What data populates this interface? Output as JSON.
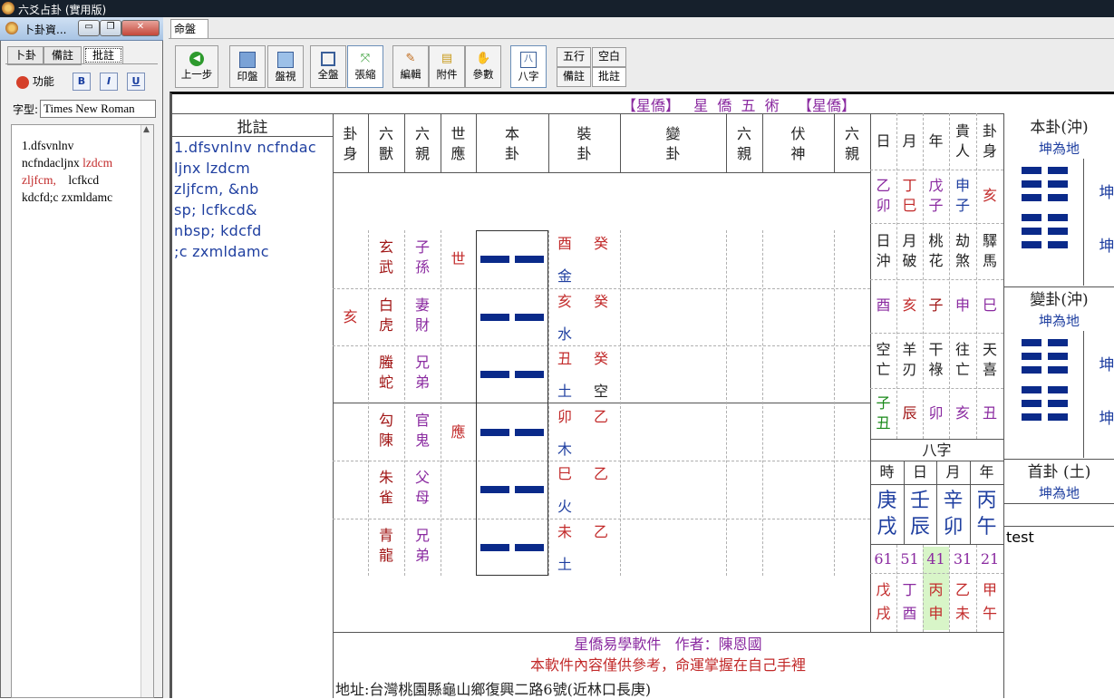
{
  "app": {
    "title": "六爻占卦 (實用版)"
  },
  "mdi_tab": "命盤",
  "toolbar": {
    "prev": "上一步",
    "print": "印盤",
    "view": "盤視",
    "full": "全盤",
    "shrink": "張縮",
    "edit": "編輯",
    "attach": "附件",
    "params": "參數",
    "bazi": "八字",
    "wuxing": "五行",
    "kongbai": "空白",
    "beizhu": "備註",
    "pizhu": "批註"
  },
  "left_panel": {
    "title": "卜卦資...",
    "tabs": [
      "卜卦",
      "備註",
      "批註"
    ],
    "func_label": "功能",
    "bold_label": "B",
    "italic_label": "I",
    "underline_label": "U",
    "font_label": "字型:",
    "font_value": "Times New Roman",
    "memo_lines": [
      [
        {
          "text": "1.dfsvnlnv",
          "c": "#000"
        }
      ],
      [
        {
          "text": "ncfndacljnx ",
          "c": "#000"
        },
        {
          "text": "lzdcm",
          "c": "#c22a2a"
        }
      ],
      [
        {
          "text": "zljfcm,",
          "c": "#c22a2a"
        },
        {
          "text": "    lcfkcd",
          "c": "#000"
        }
      ],
      [
        {
          "text": "kdcfd;c zxmldamc",
          "c": "#000"
        }
      ]
    ]
  },
  "doc": {
    "banner": "【星僑】   星  僑  五  術    【星僑】",
    "pizhu_header": "批註",
    "pizhu_lines": [
      "1.dfsvnlnv ncfndac",
      "ljnx lzdcm",
      "zljfcm, &nb",
      "sp; lcfkcd&",
      "nbsp; kdcfd",
      ";c zxmldamc"
    ],
    "col_headers": [
      "卦身",
      "六獸",
      "六親",
      "世應",
      "本卦",
      "裝卦",
      "變卦",
      "六親",
      "伏神",
      "六親"
    ],
    "rows": [
      {
        "guashen": "",
        "shou": "玄武",
        "qin": "子孫",
        "shiying": "世",
        "zhi": "酉",
        "gan": "癸",
        "wx": "金",
        "kong": ""
      },
      {
        "guashen": "亥",
        "shou": "白虎",
        "qin": "妻財",
        "shiying": "",
        "zhi": "亥",
        "gan": "癸",
        "wx": "水",
        "kong": ""
      },
      {
        "guashen": "",
        "shou": "螣蛇",
        "qin": "兄弟",
        "shiying": "",
        "zhi": "丑",
        "gan": "癸",
        "wx": "土",
        "kong": "空"
      },
      {
        "guashen": "",
        "shou": "勾陳",
        "qin": "官鬼",
        "shiying": "應",
        "zhi": "卯",
        "gan": "乙",
        "wx": "木",
        "kong": ""
      },
      {
        "guashen": "",
        "shou": "朱雀",
        "qin": "父母",
        "shiying": "",
        "zhi": "巳",
        "gan": "乙",
        "wx": "火",
        "kong": ""
      },
      {
        "guashen": "",
        "shou": "青龍",
        "qin": "兄弟",
        "shiying": "",
        "zhi": "未",
        "gan": "乙",
        "wx": "土",
        "kong": ""
      }
    ],
    "side": {
      "head": [
        "日",
        "月",
        "年",
        "貴人",
        "卦身"
      ],
      "r1": [
        "乙卯",
        "丁巳",
        "戊子",
        "申子",
        "亥"
      ],
      "r2": [
        "日沖",
        "月破",
        "桃花",
        "劫煞",
        "驛馬"
      ],
      "r3": [
        "酉",
        "亥",
        "子",
        "申",
        "巳"
      ],
      "r4": [
        "空亡",
        "羊刃",
        "干祿",
        "往亡",
        "天喜"
      ],
      "r5": [
        "子丑",
        "辰",
        "卯",
        "亥",
        "丑"
      ]
    },
    "bazi": {
      "title": "八字",
      "head": [
        "時",
        "日",
        "月",
        "年"
      ],
      "pillars": [
        "庚戌",
        "壬辰",
        "辛卯",
        "丙午"
      ],
      "ages": [
        "61",
        "51",
        "41",
        "31",
        "21"
      ],
      "dayun": [
        "戊戌",
        "丁酉",
        "丙申",
        "乙未",
        "甲午"
      ]
    },
    "right": {
      "bengua_title": "本卦(沖)",
      "bengua_name": "坤為地",
      "biangua_title": "變卦(沖)",
      "biangua_name": "坤為地",
      "shougua_title": "首卦 (土)",
      "shougua_name": "坤為地",
      "cut_char": "坤",
      "note": "test"
    },
    "footer": {
      "line1": "星僑易學軟件   作者：陳恩國",
      "line2": "本軟件內容僅供參考，命運掌握在自己手裡",
      "line3": "地址:台灣桃園縣龜山鄉復興二路6號(近林口長庚)"
    }
  },
  "colors": {
    "accent_red": "#c22a2a",
    "accent_blue": "#1f3fa0",
    "accent_purple": "#8a2aa0",
    "yao": "#0a2a8a"
  }
}
